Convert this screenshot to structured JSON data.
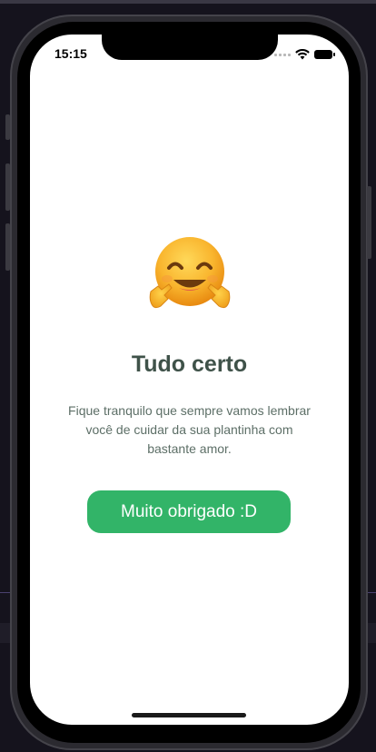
{
  "status_bar": {
    "time": "15:15"
  },
  "content": {
    "emoji_icon": "hugging-face-icon",
    "title": "Tudo certo",
    "subtitle": "Fique tranquilo que sempre vamos lembrar você de cuidar da sua plantinha com bastante amor.",
    "button_label": "Muito obrigado :D"
  },
  "colors": {
    "background": "#ffffff",
    "title": "#3f5249",
    "subtitle": "#5d6f67",
    "button": "#32b468",
    "button_text": "#ffffff"
  }
}
